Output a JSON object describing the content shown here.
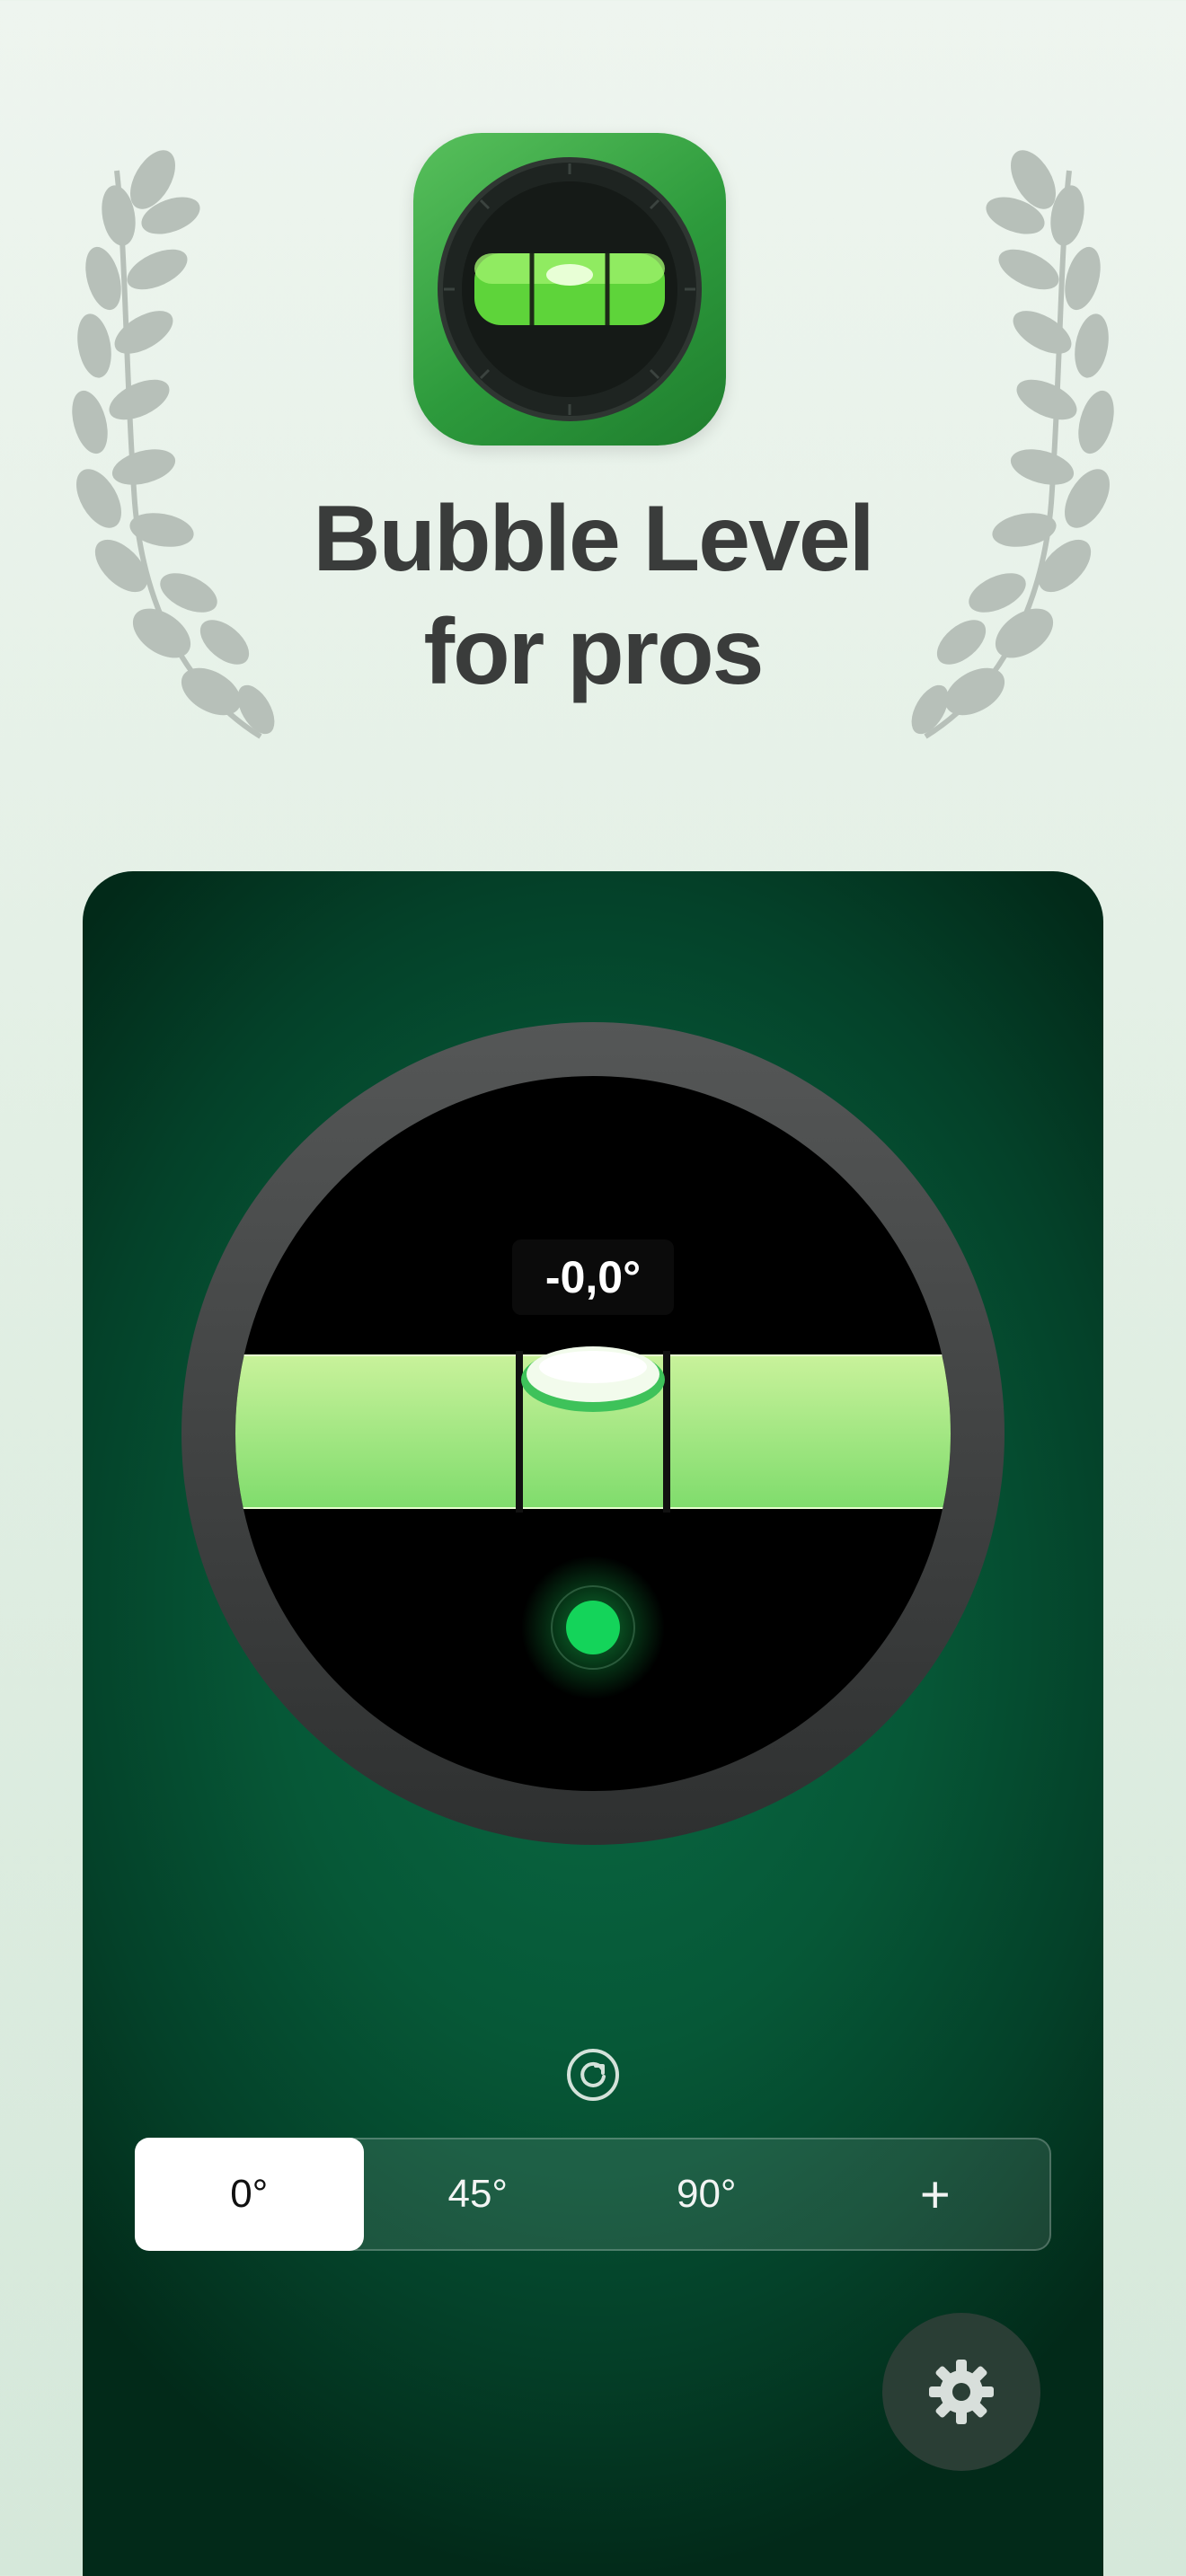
{
  "promo": {
    "title_line1": "Bubble Level",
    "title_line2": "for pros",
    "app_icon": "bubble-level-app-icon",
    "decoration": "laurel-wreath"
  },
  "level": {
    "reading": "-0,0°",
    "accent_color": "#98e07a",
    "indicator_color": "#14d45a"
  },
  "modes": {
    "options": [
      "0°",
      "45°",
      "90°",
      "+"
    ],
    "selected": "0°"
  },
  "icons": {
    "recalibrate": "refresh-icon",
    "settings": "gear-icon"
  }
}
